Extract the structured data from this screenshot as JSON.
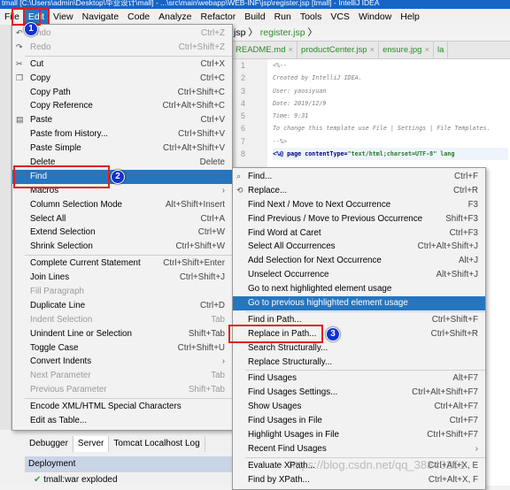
{
  "window": {
    "title": "tmall [C:\\Users\\admin\\Desktop\\毕业设计\\mall] - ...\\src\\main\\webapp\\WEB-INF\\jsp\\register.jsp [tmall] - IntelliJ IDEA"
  },
  "menubar": [
    "File",
    "Edit",
    "View",
    "Navigate",
    "Code",
    "Analyze",
    "Refactor",
    "Build",
    "Run",
    "Tools",
    "VCS",
    "Window",
    "Help"
  ],
  "breadcrumb": {
    "prev": "jsp",
    "current": "register.jsp"
  },
  "tabs": [
    "README.md",
    "productCenter.jsp",
    "ensure.jpg",
    "la"
  ],
  "editor": {
    "lines": [
      "1",
      "2",
      "3",
      "4",
      "5",
      "6",
      "7",
      "8"
    ],
    "code": [
      "<%--",
      "  Created by IntelliJ IDEA.",
      "  User: yaosiyuan",
      "  Date: 2019/12/9",
      "  Time: 9:31",
      "  To change this template use File | Settings | File Templates.",
      "--%>"
    ],
    "directive": "<%@ page contentType=",
    "directive_value": "\"text/html;charset=UTF-8\" lang"
  },
  "edit_menu": [
    {
      "label": "Undo",
      "shortcut": "Ctrl+Z",
      "disabled": true,
      "icon": "undo-icon"
    },
    {
      "label": "Redo",
      "shortcut": "Ctrl+Shift+Z",
      "disabled": true,
      "icon": "redo-icon"
    },
    {
      "sep": true
    },
    {
      "label": "Cut",
      "shortcut": "Ctrl+X",
      "icon": "cut-icon"
    },
    {
      "label": "Copy",
      "shortcut": "Ctrl+C",
      "icon": "copy-icon"
    },
    {
      "label": "Copy Path",
      "shortcut": "Ctrl+Shift+C"
    },
    {
      "label": "Copy Reference",
      "shortcut": "Ctrl+Alt+Shift+C"
    },
    {
      "label": "Paste",
      "shortcut": "Ctrl+V",
      "icon": "paste-icon"
    },
    {
      "label": "Paste from History...",
      "shortcut": "Ctrl+Shift+V"
    },
    {
      "label": "Paste Simple",
      "shortcut": "Ctrl+Alt+Shift+V"
    },
    {
      "label": "Delete",
      "shortcut": "Delete"
    },
    {
      "label": "Find",
      "submenu": true,
      "highlighted": true
    },
    {
      "label": "Macros",
      "submenu": true
    },
    {
      "label": "Column Selection Mode",
      "shortcut": "Alt+Shift+Insert"
    },
    {
      "label": "Select All",
      "shortcut": "Ctrl+A"
    },
    {
      "label": "Extend Selection",
      "shortcut": "Ctrl+W"
    },
    {
      "label": "Shrink Selection",
      "shortcut": "Ctrl+Shift+W"
    },
    {
      "sep": true
    },
    {
      "label": "Complete Current Statement",
      "shortcut": "Ctrl+Shift+Enter"
    },
    {
      "label": "Join Lines",
      "shortcut": "Ctrl+Shift+J"
    },
    {
      "label": "Fill Paragraph",
      "disabled": true
    },
    {
      "label": "Duplicate Line",
      "shortcut": "Ctrl+D"
    },
    {
      "label": "Indent Selection",
      "shortcut": "Tab",
      "disabled": true
    },
    {
      "label": "Unindent Line or Selection",
      "shortcut": "Shift+Tab"
    },
    {
      "label": "Toggle Case",
      "shortcut": "Ctrl+Shift+U"
    },
    {
      "label": "Convert Indents",
      "submenu": true
    },
    {
      "label": "Next Parameter",
      "shortcut": "Tab",
      "disabled": true
    },
    {
      "label": "Previous Parameter",
      "shortcut": "Shift+Tab",
      "disabled": true
    },
    {
      "sep": true
    },
    {
      "label": "Encode XML/HTML Special Characters"
    },
    {
      "label": "Edit as Table..."
    }
  ],
  "find_menu": [
    {
      "label": "Find...",
      "shortcut": "Ctrl+F",
      "icon": "search-icon"
    },
    {
      "label": "Replace...",
      "shortcut": "Ctrl+R",
      "icon": "replace-icon"
    },
    {
      "label": "Find Next / Move to Next Occurrence",
      "shortcut": "F3"
    },
    {
      "label": "Find Previous / Move to Previous Occurrence",
      "shortcut": "Shift+F3"
    },
    {
      "label": "Find Word at Caret",
      "shortcut": "Ctrl+F3"
    },
    {
      "label": "Select All Occurrences",
      "shortcut": "Ctrl+Alt+Shift+J"
    },
    {
      "label": "Add Selection for Next Occurrence",
      "shortcut": "Alt+J"
    },
    {
      "label": "Unselect Occurrence",
      "shortcut": "Alt+Shift+J"
    },
    {
      "label": "Go to next highlighted element usage",
      "shortcut": ""
    },
    {
      "label": "Go to previous highlighted element usage",
      "shortcut": "",
      "highlighted": true
    },
    {
      "sep": true
    },
    {
      "label": "Find in Path...",
      "shortcut": "Ctrl+Shift+F"
    },
    {
      "label": "Replace in Path...",
      "shortcut": "Ctrl+Shift+R"
    },
    {
      "label": "Search Structurally...",
      "shortcut": ""
    },
    {
      "label": "Replace Structurally...",
      "shortcut": ""
    },
    {
      "sep": true
    },
    {
      "label": "Find Usages",
      "shortcut": "Alt+F7"
    },
    {
      "label": "Find Usages Settings...",
      "shortcut": "Ctrl+Alt+Shift+F7"
    },
    {
      "label": "Show Usages",
      "shortcut": "Ctrl+Alt+F7"
    },
    {
      "label": "Find Usages in File",
      "shortcut": "Ctrl+F7"
    },
    {
      "label": "Highlight Usages in File",
      "shortcut": "Ctrl+Shift+F7"
    },
    {
      "label": "Recent Find Usages",
      "submenu": true
    },
    {
      "sep": true
    },
    {
      "label": "Evaluate XPath...",
      "shortcut": "Ctrl+Alt+X, E"
    },
    {
      "label": "Find by XPath...",
      "shortcut": "Ctrl+Alt+X, F"
    }
  ],
  "bottom_panel": {
    "tabs": [
      "Debugger",
      "Server",
      "Tomcat Localhost Log"
    ],
    "deployment_header": "Deployment",
    "deployment_item": "tmall:war exploded"
  },
  "badges": [
    "1",
    "2",
    "3"
  ],
  "watermark": "https://blog.csdn.net/qq_38840251",
  "colors": {
    "highlight": "#2675bf",
    "annotation": "#e02020",
    "badge": "#1030d0"
  }
}
